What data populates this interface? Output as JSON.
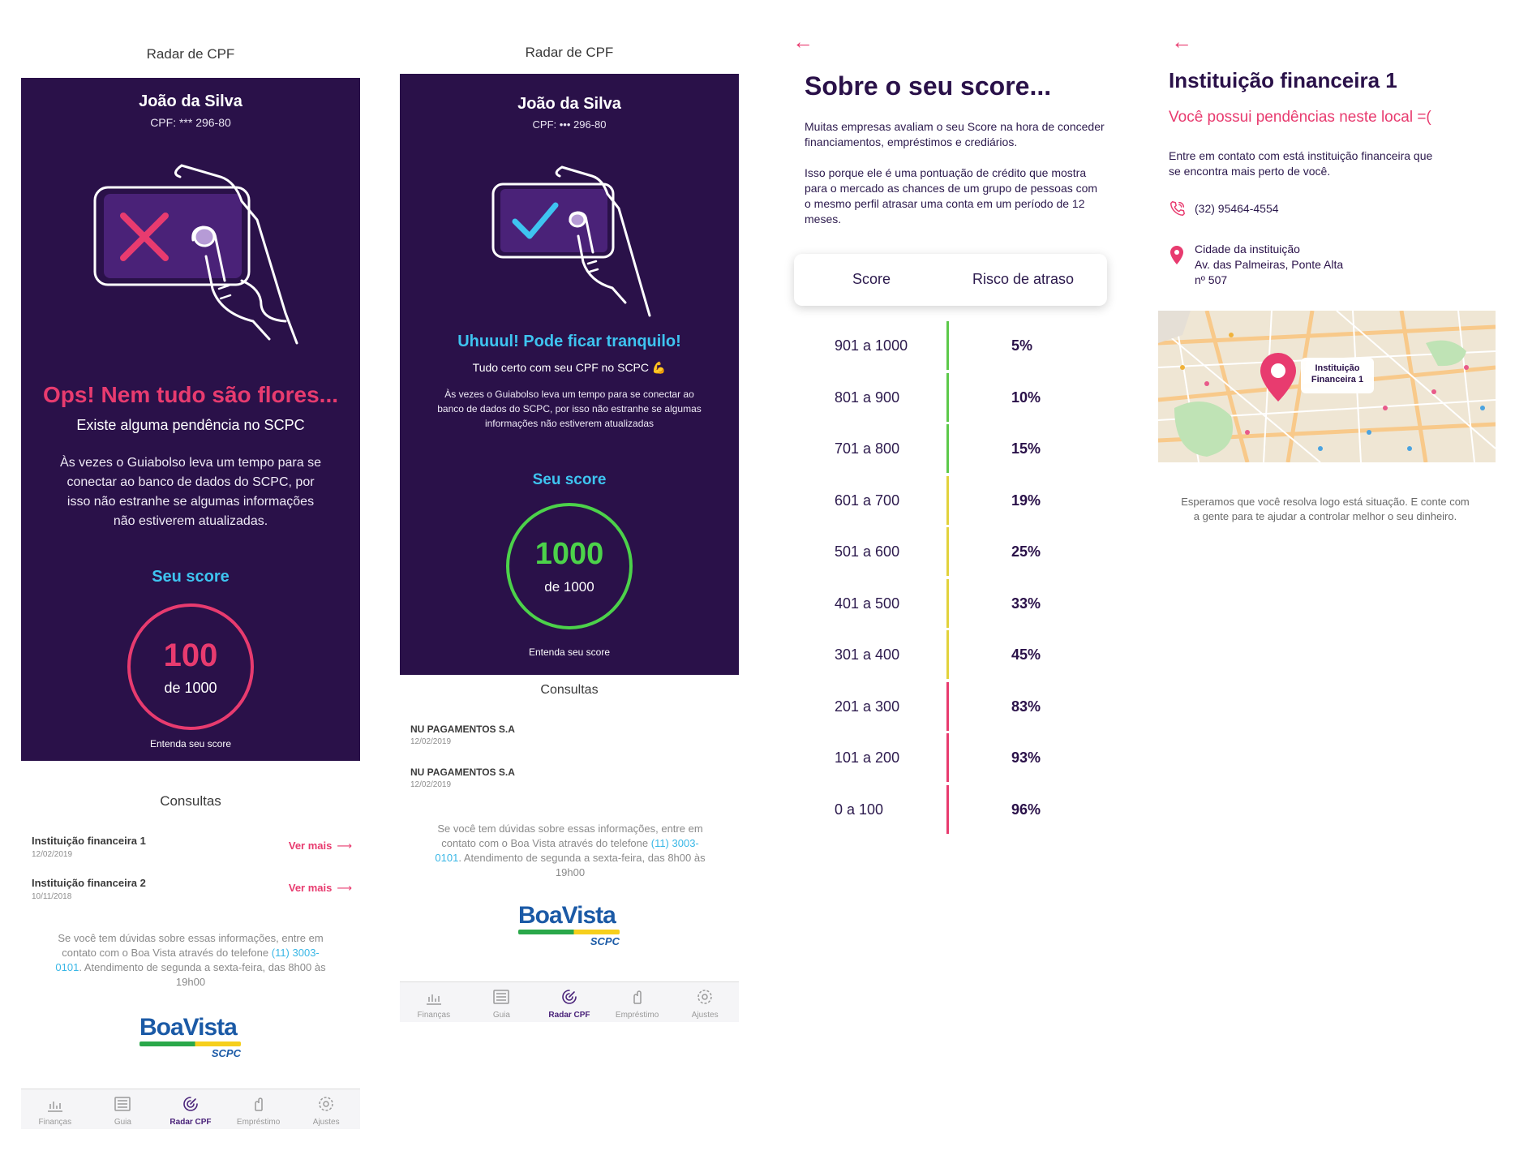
{
  "screen1": {
    "nav_title": "Radar de CPF",
    "user_name": "João da Silva",
    "cpf": "CPF: *** 296-80",
    "headline": "Ops! Nem tudo são flores...",
    "subhead": "Existe alguma pendência no SCPC",
    "body": "Às vezes o Guiabolso leva um tempo para se conectar ao banco de dados do SCPC, por isso não estranhe se algumas informações não estiverem atualizadas.",
    "score_title": "Seu score",
    "score_value": "100",
    "score_of": "de 1000",
    "understand": "Entenda seu score",
    "consultas_title": "Consultas",
    "consultas": [
      {
        "name": "Instituição financeira 1",
        "date": "12/02/2019",
        "more": "Ver mais"
      },
      {
        "name": "Instituição financeira 2",
        "date": "10/11/2018",
        "more": "Ver mais"
      }
    ],
    "help_before": "Se você tem dúvidas sobre essas informações, entre em contato com o Boa Vista através do telefone ",
    "help_phone": "(11) 3003-0101",
    "help_after": ". Atendimento de segunda a sexta-feira, das 8h00 às 19h00",
    "ring_color": "#e83b6f"
  },
  "screen2": {
    "nav_title": "Radar de CPF",
    "user_name": "João da Silva",
    "cpf": "CPF: ••• 296-80",
    "headline": "Uhuuul! Pode ficar tranquilo!",
    "subhead": "Tudo certo com seu CPF no SCPC 💪",
    "body": "Às vezes o Guiabolso leva um tempo para se conectar ao banco de dados do SCPC, por isso não estranhe se algumas informações não estiverem atualizadas",
    "score_title": "Seu score",
    "score_value": "1000",
    "score_of": "de 1000",
    "understand": "Entenda seu score",
    "consultas_title": "Consultas",
    "consultas": [
      {
        "name": "NU PAGAMENTOS S.A",
        "date": "12/02/2019"
      },
      {
        "name": "NU PAGAMENTOS S.A",
        "date": "12/02/2019"
      }
    ],
    "help_before": "Se você tem dúvidas sobre essas informações, entre em contato com o Boa Vista através do telefone ",
    "help_phone": "(11) 3003-0101",
    "help_after": ". Atendimento de segunda a sexta-feira, das 8h00 às 19h00",
    "ring_color": "#4cd24a"
  },
  "logo": {
    "brand": "BoaVista",
    "sub": "SCPC"
  },
  "tabbar": {
    "tabs": [
      {
        "label": "Finanças",
        "icon": "chart-icon"
      },
      {
        "label": "Guia",
        "icon": "guide-icon"
      },
      {
        "label": "Radar CPF",
        "icon": "radar-icon",
        "active": true
      },
      {
        "label": "Empréstimo",
        "icon": "loan-icon"
      },
      {
        "label": "Ajustes",
        "icon": "gear-icon"
      }
    ]
  },
  "screen3": {
    "back": "←",
    "title": "Sobre o seu score...",
    "para1": "Muitas empresas avaliam o seu Score na hora de conceder financiamentos, empréstimos e crediários.",
    "para2": "Isso porque ele é uma pontuação de crédito que mostra para o mercado as chances de um grupo de pessoas com o mesmo perfil atrasar uma conta em um período de 12 meses.",
    "col_score": "Score",
    "col_risk": "Risco de atraso",
    "rows": [
      {
        "range": "901 a 1000",
        "risk": "5%",
        "color": "#5cc94a"
      },
      {
        "range": "801 a 900",
        "risk": "10%",
        "color": "#5cc94a"
      },
      {
        "range": "701 a 800",
        "risk": "15%",
        "color": "#5cc94a"
      },
      {
        "range": "601 a 700",
        "risk": "19%",
        "color": "#e2d23c"
      },
      {
        "range": "501 a 600",
        "risk": "25%",
        "color": "#e2d23c"
      },
      {
        "range": "401 a 500",
        "risk": "33%",
        "color": "#e2d23c"
      },
      {
        "range": "301 a 400",
        "risk": "45%",
        "color": "#e2d23c"
      },
      {
        "range": "201 a 300",
        "risk": "83%",
        "color": "#e83b6f"
      },
      {
        "range": "101 a 200",
        "risk": "93%",
        "color": "#e83b6f"
      },
      {
        "range": "0 a 100",
        "risk": "96%",
        "color": "#e83b6f"
      }
    ]
  },
  "screen4": {
    "back": "←",
    "title": "Instituição financeira 1",
    "warn": "Você possui pendências neste local =(",
    "contact": "Entre em contato com está instituição financeira que se encontra mais perto de você.",
    "phone": "(32) 95464-4554",
    "addr_line1": "Cidade da instituição",
    "addr_line2": "Av. das Palmeiras, Ponte Alta",
    "addr_line3": "nº 507",
    "map_label": "Instituição Financeira 1",
    "footer": "Esperamos que você resolva logo está situação. E conte com a gente para te ajudar a controlar melhor o seu dinheiro."
  }
}
